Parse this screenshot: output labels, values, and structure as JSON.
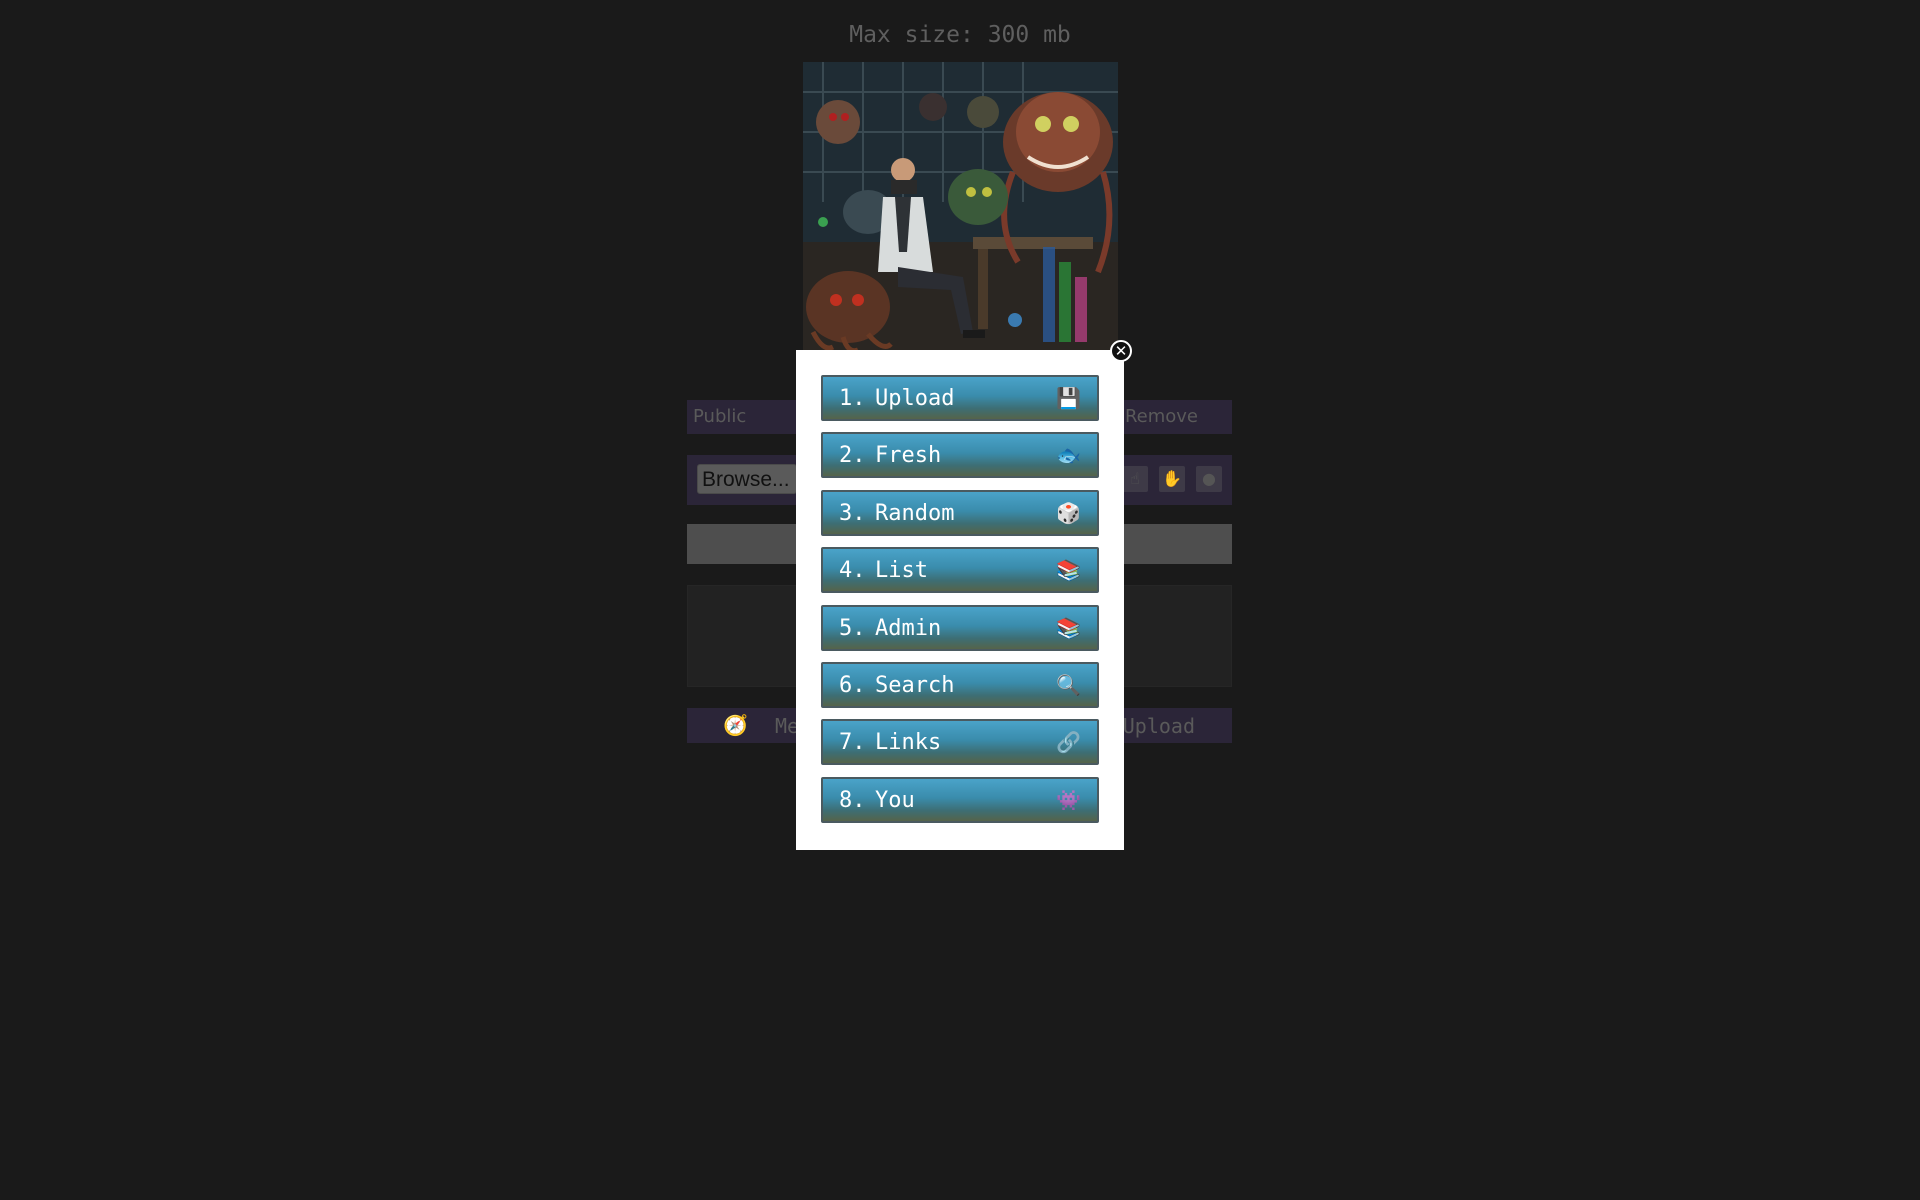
{
  "header": {
    "max_size": "Max size: 300 mb"
  },
  "background_form": {
    "public_label": "Public",
    "remove_label": "Remove",
    "browse_label": "Browse...",
    "bottom_compass_icon": "compass-icon",
    "bottom_meta_label": "Me",
    "bottom_upload_label": "Upload"
  },
  "menu": {
    "close_label": "✕",
    "items": [
      {
        "number": "1.",
        "label": "Upload",
        "icon": "floppy-disk-icon",
        "glyph": "💾"
      },
      {
        "number": "2.",
        "label": "Fresh",
        "icon": "fish-icon",
        "glyph": "🐟"
      },
      {
        "number": "3.",
        "label": "Random",
        "icon": "dice-icon",
        "glyph": "🎲"
      },
      {
        "number": "4.",
        "label": "List",
        "icon": "books-icon",
        "glyph": "📚"
      },
      {
        "number": "5.",
        "label": "Admin",
        "icon": "books-icon",
        "glyph": "📚"
      },
      {
        "number": "6.",
        "label": "Search",
        "icon": "magnifier-icon",
        "glyph": "🔍"
      },
      {
        "number": "7.",
        "label": "Links",
        "icon": "link-icon",
        "glyph": "🔗"
      },
      {
        "number": "8.",
        "label": "You",
        "icon": "alien-icon",
        "glyph": "👾"
      }
    ]
  }
}
